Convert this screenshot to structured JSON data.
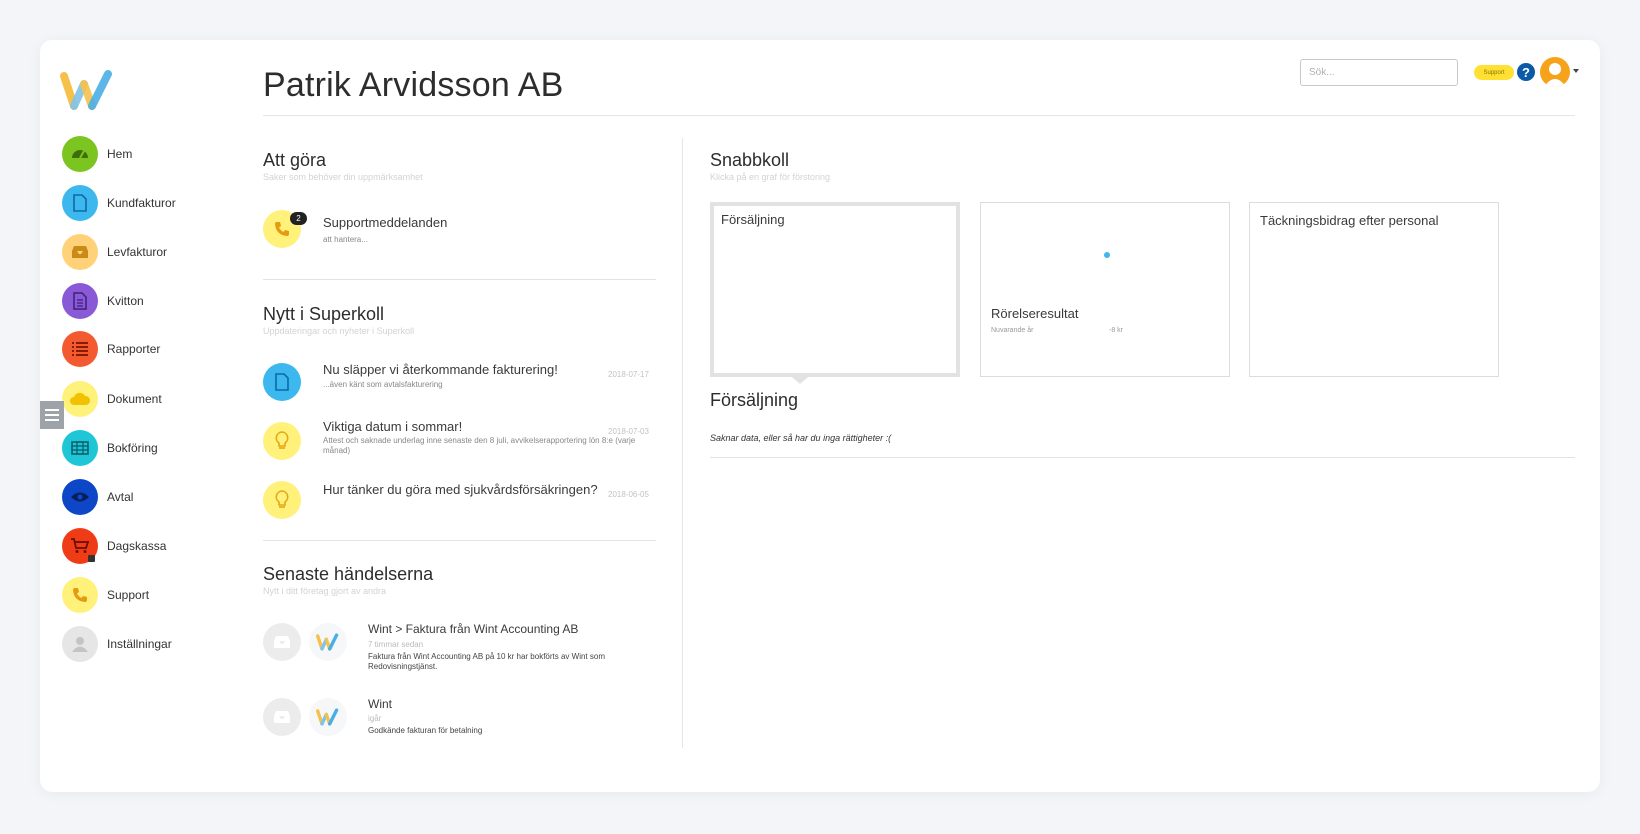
{
  "app": {
    "title": "Patrik Arvidsson AB"
  },
  "header": {
    "search_placeholder": "Sök...",
    "support_label": "Support",
    "help_glyph": "?"
  },
  "sidebar": {
    "items": [
      {
        "label": "Hem",
        "icon": "speedometer-icon",
        "color": "#7cc41f"
      },
      {
        "label": "Kundfakturor",
        "icon": "document-icon",
        "color": "#3db8ee"
      },
      {
        "label": "Levfakturor",
        "icon": "inbox-tray-icon",
        "color": "#ffd27a"
      },
      {
        "label": "Kvitton",
        "icon": "receipt-icon",
        "color": "#8a5ad6"
      },
      {
        "label": "Rapporter",
        "icon": "list-icon",
        "color": "#f45a30"
      },
      {
        "label": "Dokument",
        "icon": "cloud-icon",
        "color": "#fff27a"
      },
      {
        "label": "Bokföring",
        "icon": "table-grid-icon",
        "color": "#1fc6d6"
      },
      {
        "label": "Avtal",
        "icon": "eye-icon",
        "color": "#0d47c7"
      },
      {
        "label": "Dagskassa",
        "icon": "cart-icon",
        "color": "#f03c16"
      },
      {
        "label": "Support",
        "icon": "phone-icon",
        "color": "#fff17a"
      },
      {
        "label": "Inställningar",
        "icon": "user-icon",
        "color": "#e6e6e6"
      }
    ]
  },
  "todo": {
    "title": "Att göra",
    "subtitle": "Saker som behöver din uppmärksamhet",
    "items": [
      {
        "title": "Supportmeddelanden",
        "sub": "att hantera...",
        "badge": "2"
      }
    ]
  },
  "news": {
    "title": "Nytt i Superkoll",
    "subtitle": "Uppdateringar och nyheter i Superkoll",
    "items": [
      {
        "title": "Nu släpper vi återkommande fakturering!",
        "sub": "...även känt som avtalsfakturering",
        "date": "2018-07-17"
      },
      {
        "title": "Viktiga datum i sommar!",
        "sub": "Attest och saknade underlag inne senaste den 8 juli, avvikelserapportering lön 8:e (varje månad)",
        "date": "2018-07-03"
      },
      {
        "title": "Hur tänker du göra med sjukvårdsförsäkringen?",
        "sub": "",
        "date": "2018-06-05"
      }
    ]
  },
  "events": {
    "title": "Senaste händelserna",
    "subtitle": "Nytt i ditt företag gjort av andra",
    "items": [
      {
        "title": "Wint > Faktura från Wint Accounting AB",
        "time": "7 timmar sedan",
        "body": "Faktura från Wint Accounting AB på 10 kr har bokförts av Wint som Redovisningstjänst."
      },
      {
        "title": "Wint",
        "time": "igår",
        "body": "Godkände fakturan för betalning"
      }
    ]
  },
  "quick": {
    "title": "Snabbkoll",
    "subtitle": "Klicka på en graf för förstoring",
    "tiles": [
      {
        "title": "Försäljning"
      },
      {
        "title": "Rörelseresultat",
        "meta_label": "Nuvarande år",
        "meta_value": "-8 kr"
      },
      {
        "title": "Täckningsbidrag efter personal"
      }
    ]
  },
  "sales": {
    "title": "Försäljning",
    "message": "Saknar data, eller så har du inga rättigheter :("
  }
}
